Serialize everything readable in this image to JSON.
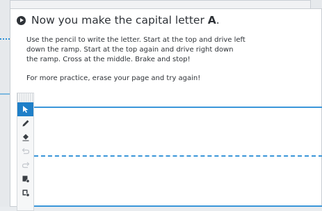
{
  "heading": {
    "prefix": "Now you make the capital letter ",
    "letter": "A",
    "suffix": "."
  },
  "instructions": "Use the pencil to write the letter. Start at the top and drive left down the ramp. Start at the top again and drive right down the ramp. Cross at the middle. Brake and stop!",
  "practice": "For more practice, erase your page and try again!",
  "toolbar": {
    "tools": [
      "pointer-icon",
      "pencil-icon",
      "eraser-icon",
      "undo-icon",
      "redo-icon",
      "clear-page-icon",
      "clear-all-icon"
    ],
    "active_tool": "pointer-icon"
  },
  "colors": {
    "accent": "#1f7fc8",
    "guide_line": "#3a96d9",
    "text": "#2f3338"
  }
}
